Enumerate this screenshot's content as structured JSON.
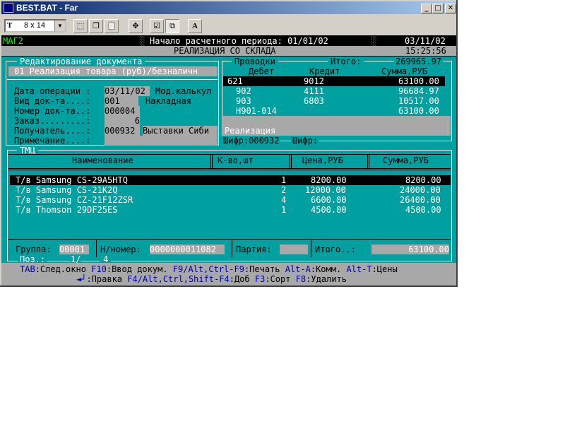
{
  "window": {
    "title": "BEST.BAT - Far"
  },
  "toolbar": {
    "font_size": "8 x 14",
    "font_icon": "T"
  },
  "header": {
    "store": "МАГ2",
    "period_label": "Начало расчетного периода: 01/01/02",
    "date": "03/11/02",
    "time": "15:25:56",
    "title": "РЕАЛИЗАЦИЯ СО СКЛАДА"
  },
  "doc": {
    "section_title": "Редактирование документа",
    "doc_type_line": "01 Реализация товара (руб)/безналичн",
    "op_date_label": "Дата операции :",
    "op_date": "03/11/02",
    "mod_label": "Мод.калькул",
    "doc_kind_label": "Вид док-та....:",
    "doc_kind_code": "001",
    "doc_kind_name": "Накладная",
    "doc_num_label": "Номер док-та..:",
    "doc_num": "000004",
    "order_label": "Заказ.........:",
    "order": "6",
    "recipient_label": "Получатель....:",
    "recipient_code": "000932",
    "recipient_name": "Выставки Сиби",
    "note_label": "Примечание....:"
  },
  "postings": {
    "title": "Проводки",
    "total_label": "Итого:",
    "total": "269965.97",
    "col_debit": "Дебет",
    "col_credit": "Кредит",
    "col_sum": "Сумма,РУБ",
    "rows": [
      {
        "debit": "621",
        "credit": "9012",
        "sum": "63100.00"
      },
      {
        "debit": "902",
        "credit": "4111",
        "sum": "96684.97"
      },
      {
        "debit": "903",
        "credit": "6803",
        "sum": "10517.00"
      },
      {
        "debit": "Н901-014",
        "credit": "",
        "sum": "63100.00"
      }
    ],
    "note": "Реализация",
    "cipher_label": "Шифр:000932",
    "cipher_label2": "Шифр:"
  },
  "goods": {
    "title": "ТМЦ",
    "col_name": "Наименование",
    "col_qty": "К-во,шт",
    "col_price": "Цена,РУБ",
    "col_sum": "Сумма,РУБ",
    "rows": [
      {
        "name": "Т/в Samsung CS-29A5HTQ",
        "qty": "1",
        "price": "8200.00",
        "sum": "8200.00"
      },
      {
        "name": "Т/в Samsung CS-21K2Q",
        "qty": "2",
        "price": "12000.00",
        "sum": "24000.00"
      },
      {
        "name": "Т/в Samsung CZ-21F12ZSR",
        "qty": "4",
        "price": "6600.00",
        "sum": "26400.00"
      },
      {
        "name": "Т/в Thomson 29DF25ES",
        "qty": "1",
        "price": "4500.00",
        "sum": "4500.00"
      }
    ],
    "group_label": "Группа:",
    "group": "00001",
    "nnum_label": "Н/номер:",
    "nnum": "0000000011082",
    "batch_label": "Партия:",
    "total_label": "Итого..:",
    "total": "63100.00",
    "pos_label": "Поз.:",
    "pos": "1/",
    "pos_total": "4"
  },
  "keybar": {
    "k1": "TAB",
    "l1": ":След.окно ",
    "k2": "F10",
    "l2": ":Ввод докум. ",
    "k3": "F9/Alt,Ctrl-F9",
    "l3": ":Печать ",
    "k4": "Alt-A",
    "l4": ":Комм. ",
    "k5": "Alt-T",
    "l5": ":Цены",
    "k6": "◄┘",
    "l6": ":Правка ",
    "k7": "F4/Alt,Ctrl,Shift-F4",
    "l7": ":Доб ",
    "k8": "F3",
    "l8": ":Сорт ",
    "k9": "F8",
    "l9": ":Удалить"
  },
  "colors": {
    "cyan": "#00a0a0",
    "gray": "#a8a8a8",
    "title_blue": "#0a246a"
  }
}
